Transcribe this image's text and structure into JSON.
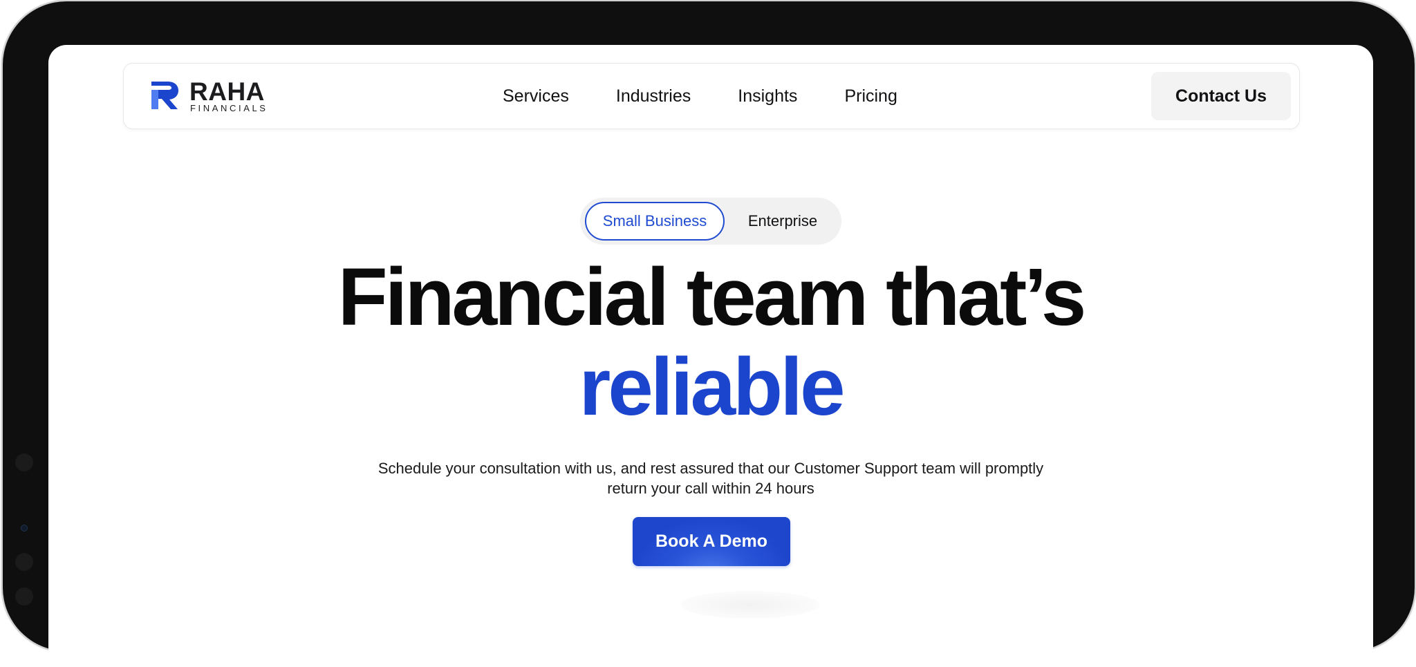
{
  "brand": {
    "name": "RAHA",
    "tagline": "FINANCIALS",
    "accent_color": "#1c45cd"
  },
  "nav": {
    "links": [
      "Services",
      "Industries",
      "Insights",
      "Pricing"
    ],
    "contact_label": "Contact Us"
  },
  "segment_toggle": {
    "options": [
      "Small Business",
      "Enterprise"
    ],
    "selected": "Small Business"
  },
  "hero": {
    "headline": "Financial team that’s",
    "highlight": "reliable",
    "subtext": "Schedule your consultation with us, and rest assured that our Customer Support team will promptly return your call within 24 hours",
    "cta_label": "Book A Demo"
  }
}
